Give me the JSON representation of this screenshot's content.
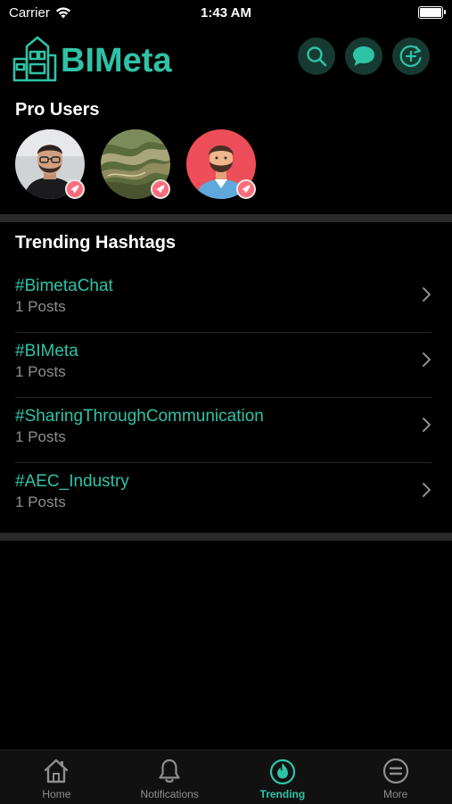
{
  "status_bar": {
    "carrier": "Carrier",
    "time": "1:43 AM",
    "battery_level": 1.0
  },
  "header": {
    "logo_text": "BIMeta",
    "buttons": [
      {
        "icon": "search-icon"
      },
      {
        "icon": "chat-bubble-icon"
      },
      {
        "icon": "refresh-plus-icon"
      }
    ]
  },
  "pro_users": {
    "title": "Pro Users",
    "users": [
      {
        "avatar": "photo-man-glasses"
      },
      {
        "avatar": "photo-landscape"
      },
      {
        "avatar": "illustrated-bearded-man"
      }
    ],
    "badge_icon": "rocket-icon"
  },
  "trending": {
    "title": "Trending Hashtags",
    "items": [
      {
        "tag": "#BimetaChat",
        "count": "1 Posts"
      },
      {
        "tag": "#BIMeta",
        "count": "1 Posts"
      },
      {
        "tag": "#SharingThroughCommunication",
        "count": "1 Posts"
      },
      {
        "tag": "#AEC_Industry",
        "count": "1 Posts"
      }
    ]
  },
  "tab_bar": {
    "tabs": [
      {
        "label": "Home",
        "icon": "home-icon"
      },
      {
        "label": "Notifications",
        "icon": "bell-icon"
      },
      {
        "label": "Trending",
        "icon": "flame-icon"
      },
      {
        "label": "More",
        "icon": "menu-circle-icon"
      }
    ],
    "active": "Trending"
  },
  "colors": {
    "accent": "#2fc3a6",
    "background": "#000000",
    "badge": "#ff6b7b"
  }
}
